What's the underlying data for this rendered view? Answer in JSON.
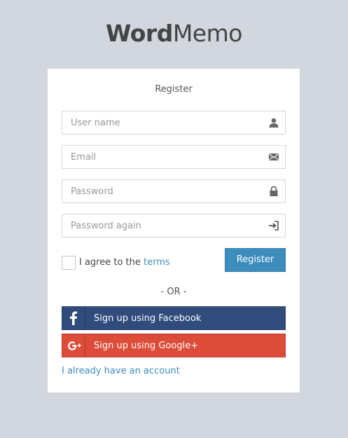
{
  "logo": {
    "bold": "Word",
    "light": "Memo"
  },
  "form": {
    "title": "Register",
    "fields": [
      {
        "placeholder": "User name",
        "icon": "user-icon"
      },
      {
        "placeholder": "Email",
        "icon": "envelope-icon"
      },
      {
        "placeholder": "Password",
        "icon": "lock-icon"
      },
      {
        "placeholder": "Password again",
        "icon": "login-icon"
      }
    ],
    "agree_text": "I agree to the",
    "terms_label": "terms",
    "register_label": "Register",
    "or_text": "- OR -",
    "facebook_label": "Sign up using Facebook",
    "google_label": "Sign up using Google+",
    "account_link": "I already have an account"
  },
  "colors": {
    "background": "#d2d6de",
    "primary": "#3c8dbc",
    "facebook": "#2f4c7d",
    "google": "#dd4b39"
  }
}
